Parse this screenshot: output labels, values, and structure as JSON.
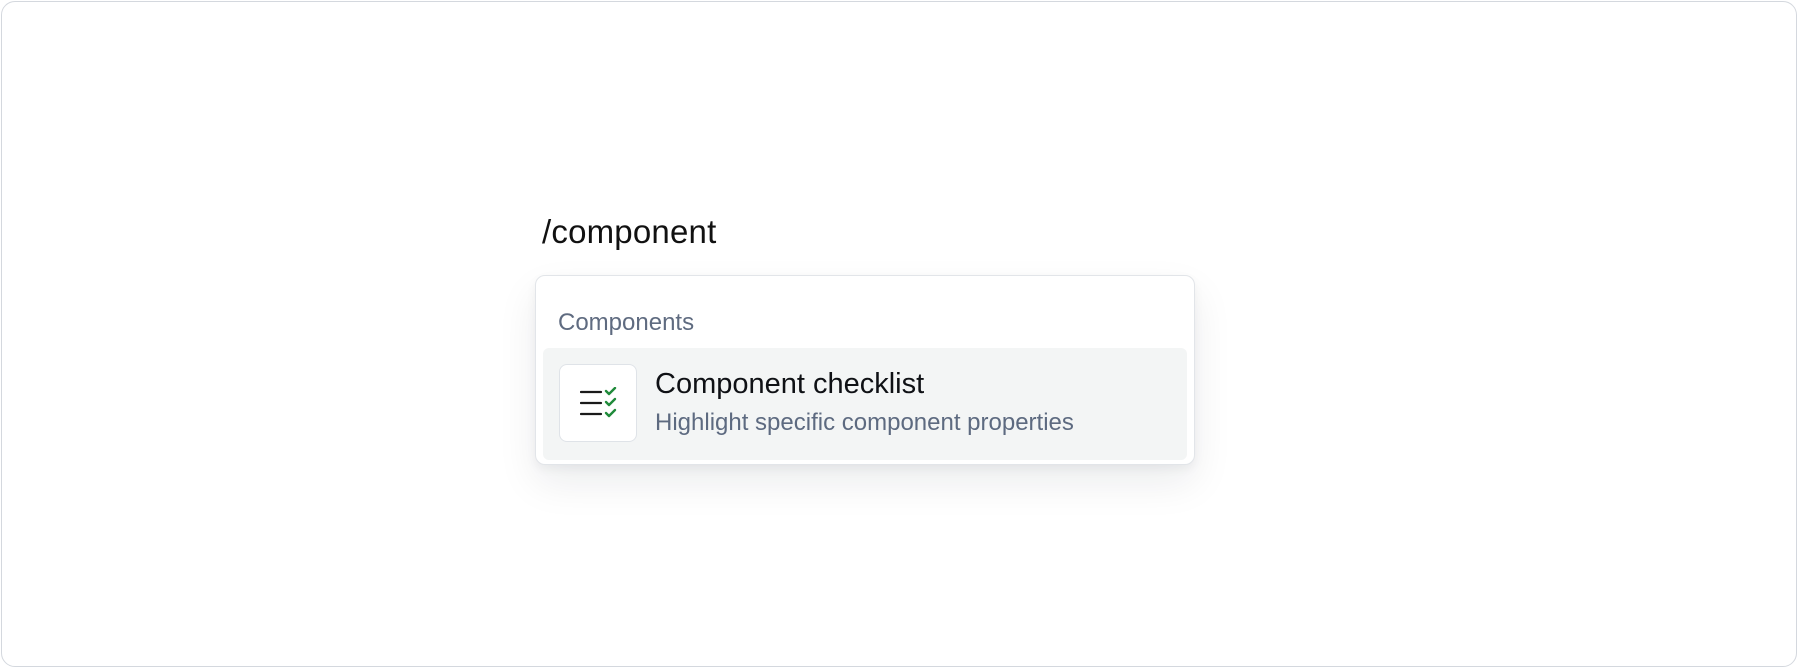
{
  "editor": {
    "command_text": "/component"
  },
  "menu": {
    "section_title": "Components",
    "items": [
      {
        "title": "Component checklist",
        "subtitle": "Highlight specific component properties",
        "icon": "checklist-icon"
      }
    ]
  },
  "colors": {
    "check_green": "#1f8a3a",
    "highlight_bg": "#f3f5f5",
    "secondary_text": "#5f6b80"
  }
}
